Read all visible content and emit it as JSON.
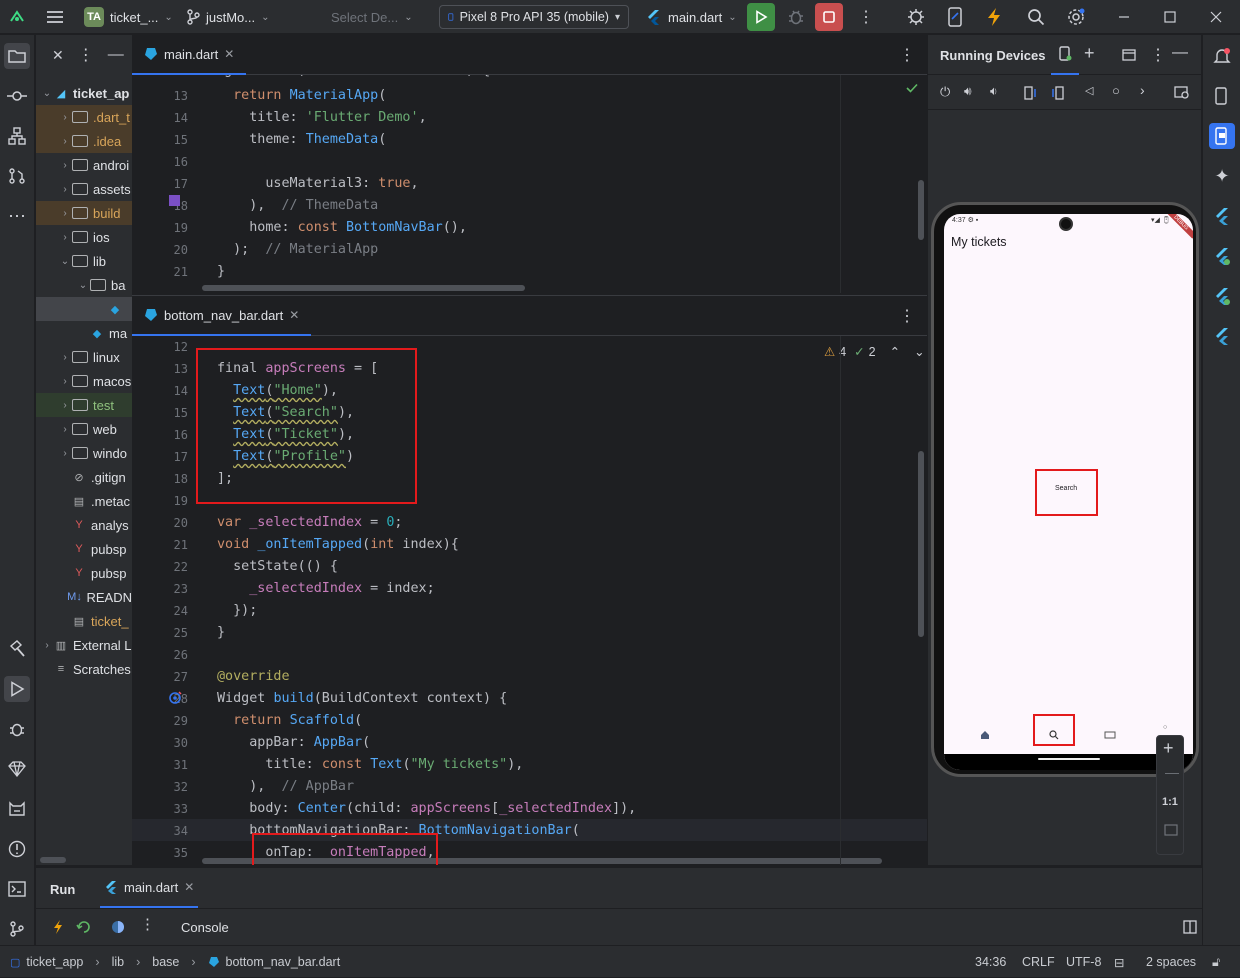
{
  "titlebar": {
    "project_badge": "TA",
    "project_name": "ticket_...",
    "branch": "justMo...",
    "select_device": "Select De...",
    "device": "Pixel 8 Pro API 35 (mobile)",
    "run_config": "main.dart"
  },
  "project_tree": {
    "items": [
      {
        "label": "ticket_ap",
        "indent": 0,
        "chevron": "open",
        "icon": "flutter-icon",
        "style": "",
        "bold": true
      },
      {
        "label": ".dart_t",
        "indent": 1,
        "chevron": "closed",
        "icon": "folder-icon",
        "style": "orange"
      },
      {
        "label": ".idea",
        "indent": 1,
        "chevron": "closed",
        "icon": "folder-icon",
        "style": "orange"
      },
      {
        "label": "androi",
        "indent": 1,
        "chevron": "closed",
        "icon": "folder-icon",
        "style": ""
      },
      {
        "label": "assets",
        "indent": 1,
        "chevron": "closed",
        "icon": "folder-icon",
        "style": ""
      },
      {
        "label": "build",
        "indent": 1,
        "chevron": "closed",
        "icon": "folder-icon",
        "style": "orange"
      },
      {
        "label": "ios",
        "indent": 1,
        "chevron": "closed",
        "icon": "folder-icon",
        "style": ""
      },
      {
        "label": "lib",
        "indent": 1,
        "chevron": "open",
        "icon": "folder-icon",
        "style": ""
      },
      {
        "label": "ba",
        "indent": 2,
        "chevron": "open",
        "icon": "folder-icon",
        "style": ""
      },
      {
        "label": "",
        "indent": 3,
        "chevron": "",
        "icon": "dart-file-icon",
        "style": "sel"
      },
      {
        "label": "ma",
        "indent": 2,
        "chevron": "",
        "icon": "dart-file-icon",
        "style": ""
      },
      {
        "label": "linux",
        "indent": 1,
        "chevron": "closed",
        "icon": "folder-icon",
        "style": ""
      },
      {
        "label": "macos",
        "indent": 1,
        "chevron": "closed",
        "icon": "folder-icon",
        "style": ""
      },
      {
        "label": "test",
        "indent": 1,
        "chevron": "closed",
        "icon": "folder-icon",
        "style": "green"
      },
      {
        "label": "web",
        "indent": 1,
        "chevron": "closed",
        "icon": "folder-icon",
        "style": ""
      },
      {
        "label": "windo",
        "indent": 1,
        "chevron": "closed",
        "icon": "folder-icon",
        "style": ""
      },
      {
        "label": ".gitign",
        "indent": 1,
        "chevron": "",
        "icon": "ignore-file-icon",
        "style": ""
      },
      {
        "label": ".metac",
        "indent": 1,
        "chevron": "",
        "icon": "text-file-icon",
        "style": ""
      },
      {
        "label": "analys",
        "indent": 1,
        "chevron": "",
        "icon": "yaml-file-icon",
        "style": ""
      },
      {
        "label": "pubsp",
        "indent": 1,
        "chevron": "",
        "icon": "yaml-file-icon",
        "style": ""
      },
      {
        "label": "pubsp",
        "indent": 1,
        "chevron": "",
        "icon": "yaml-file-icon",
        "style": ""
      },
      {
        "label": "READN",
        "indent": 1,
        "chevron": "",
        "icon": "markdown-file-icon",
        "style": ""
      },
      {
        "label": "ticket_",
        "indent": 1,
        "chevron": "",
        "icon": "iml-file-icon",
        "style": "orange-text"
      },
      {
        "label": "External L",
        "indent": 0,
        "chevron": "closed",
        "icon": "library-icon",
        "style": ""
      },
      {
        "label": "Scratches",
        "indent": 0,
        "chevron": "",
        "icon": "scratches-icon",
        "style": ""
      }
    ]
  },
  "editor_top": {
    "tab_label": "main.dart",
    "lines": [
      {
        "n": "13",
        "html": "  <span class=\"kw\">return</span> <span class=\"ty\">MaterialApp</span>("
      },
      {
        "n": "14",
        "html": "    title: <span class=\"str\">'Flutter Demo'</span>,"
      },
      {
        "n": "15",
        "html": "    theme: <span class=\"ty\">ThemeData</span>("
      },
      {
        "n": "16",
        "html": ""
      },
      {
        "n": "17",
        "html": "      useMaterial3: <span class=\"kw\">true</span>,"
      },
      {
        "n": "18",
        "html": "    ),  <span class=\"cm\">// ThemeData</span>"
      },
      {
        "n": "19",
        "html": "    home: <span class=\"kw\">const</span> <span class=\"ty\">BottomNavBar</span>(),"
      },
      {
        "n": "20",
        "html": "  );  <span class=\"cm\">// MaterialApp</span>"
      },
      {
        "n": "21",
        "html": "}"
      }
    ]
  },
  "editor_bottom": {
    "tab_label": "bottom_nav_bar.dart",
    "warnings": "4",
    "checks": "2",
    "lines": [
      {
        "n": "12",
        "html": ""
      },
      {
        "n": "13",
        "html": "final <span class=\"fld\">appScreens</span> = ["
      },
      {
        "n": "14",
        "html": "  <span class=\"ty und\">Text</span><span class=\"und\">(</span><span class=\"str und\">\"Home\"</span>),"
      },
      {
        "n": "15",
        "html": "  <span class=\"ty und\">Text</span><span class=\"und\">(</span><span class=\"str und\">\"Search\"</span>),"
      },
      {
        "n": "16",
        "html": "  <span class=\"ty und\">Text</span><span class=\"und\">(</span><span class=\"str und\">\"Ticket\"</span>),"
      },
      {
        "n": "17",
        "html": "  <span class=\"ty und\">Text</span><span class=\"und\">(</span><span class=\"str und\">\"Profile\"</span>)"
      },
      {
        "n": "18",
        "html": "];"
      },
      {
        "n": "19",
        "html": ""
      },
      {
        "n": "20",
        "html": "<span class=\"kw\">var</span> <span class=\"fld\">_selectedIndex</span> = <span class=\"num\">0</span>;"
      },
      {
        "n": "21",
        "html": "<span class=\"kw\">void</span> <span class=\"fn\">_onItemTapped</span>(<span class=\"kw\">int</span> index){"
      },
      {
        "n": "22",
        "html": "  setState(() {"
      },
      {
        "n": "23",
        "html": "    <span class=\"fld\">_selectedIndex</span> = index;"
      },
      {
        "n": "24",
        "html": "  });"
      },
      {
        "n": "25",
        "html": "}"
      },
      {
        "n": "26",
        "html": ""
      },
      {
        "n": "27",
        "html": "<span class=\"ann\">@override</span>"
      },
      {
        "n": "28",
        "html": "Widget <span class=\"fn\">build</span>(BuildContext context) {"
      },
      {
        "n": "29",
        "html": "  <span class=\"kw\">return</span> <span class=\"ty\">Scaffold</span>("
      },
      {
        "n": "30",
        "html": "    appBar: <span class=\"ty\">AppBar</span>("
      },
      {
        "n": "31",
        "html": "      title: <span class=\"kw\">const</span> <span class=\"ty\">Text</span>(<span class=\"str\">\"My tickets\"</span>),"
      },
      {
        "n": "32",
        "html": "    ),  <span class=\"cm\">// AppBar</span>"
      },
      {
        "n": "33",
        "html": "    body: <span class=\"ty\">Center</span>(child: <span class=\"fld\">appScreens</span>[<span class=\"fld\">_selectedIndex</span>]),"
      },
      {
        "n": "34",
        "html": "    bottomNavigationBar: <span class=\"ty\">BottomNavigationBar</span>("
      },
      {
        "n": "35",
        "html": "      onTap: <span class=\"fld\">_onItemTapped</span>,"
      }
    ]
  },
  "running_devices": {
    "title": "Running Devices",
    "app_title": "My tickets",
    "body_text": "Search",
    "zoom_label": "1:1"
  },
  "bottom_panel": {
    "run_tab": "Run",
    "file_tab": "main.dart",
    "console_tab": "Console"
  },
  "status": {
    "crumbs": [
      "ticket_app",
      "lib",
      "base",
      "bottom_nav_bar.dart"
    ],
    "position": "34:36",
    "line_sep": "CRLF",
    "encoding": "UTF-8",
    "indent": "2 spaces"
  }
}
